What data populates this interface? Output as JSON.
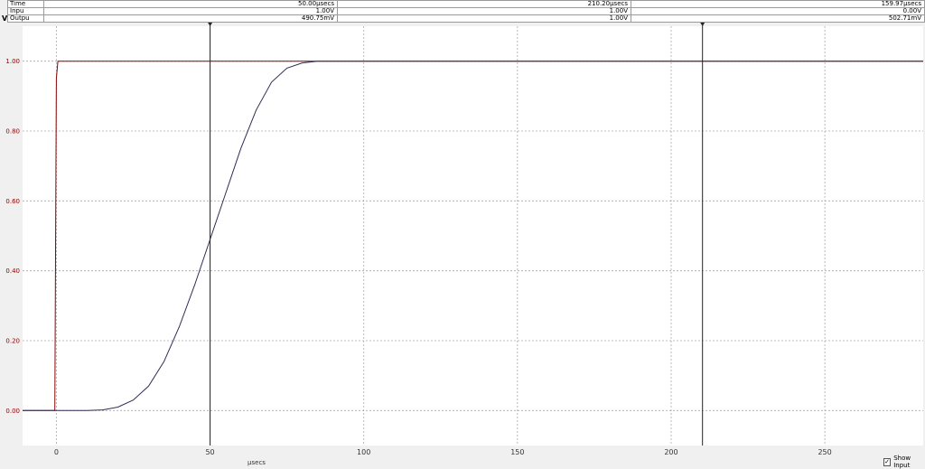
{
  "cursor_table": {
    "rows": [
      {
        "label": "Time",
        "c1": "50.00μsecs",
        "c2": "210.20μsecs",
        "c3": "159.97μsecs"
      },
      {
        "label": "Inpu",
        "c1": "1.00V",
        "c2": "1.00V",
        "c3": "0.00V"
      },
      {
        "label": "Outpu",
        "c1": "490.75mV",
        "c2": "1.00V",
        "c3": "502.71mV"
      }
    ]
  },
  "y_unit": "V",
  "show_input": {
    "label": "Show Input",
    "checked": true
  },
  "colors": {
    "input": "#8b0000",
    "output": "#2d2d55",
    "cursor": "#222222",
    "grid": "#aaaaaa",
    "axis_text_y": "#8b0000"
  },
  "chart_data": {
    "type": "line",
    "xlabel": "μsecs",
    "ylabel": "V",
    "xlim": [
      -11,
      282
    ],
    "ylim": [
      -0.1,
      1.1
    ],
    "xticks": [
      0,
      50,
      100,
      150,
      200,
      250
    ],
    "yticks": [
      0.0,
      0.2,
      0.4,
      0.6,
      0.8,
      1.0
    ],
    "ytick_labels": [
      "0.00",
      "0.20",
      "0.40",
      "0.60",
      "0.80",
      "1.00"
    ],
    "grid": true,
    "cursors": [
      50.0,
      210.2
    ],
    "series": [
      {
        "name": "Input",
        "x": [
          -11,
          -0.5,
          0,
          0.5,
          282
        ],
        "y": [
          0,
          0,
          0.95,
          1.0,
          1.0
        ]
      },
      {
        "name": "Output",
        "x": [
          -11,
          0,
          10,
          15,
          20,
          25,
          30,
          35,
          40,
          45,
          50,
          55,
          60,
          65,
          70,
          75,
          80,
          85,
          90,
          95,
          100,
          282
        ],
        "y": [
          0,
          0,
          0.0,
          0.002,
          0.01,
          0.03,
          0.07,
          0.14,
          0.24,
          0.36,
          0.49,
          0.62,
          0.75,
          0.86,
          0.94,
          0.98,
          0.995,
          1.0,
          1.0,
          1.0,
          1.0,
          1.0
        ]
      }
    ]
  }
}
